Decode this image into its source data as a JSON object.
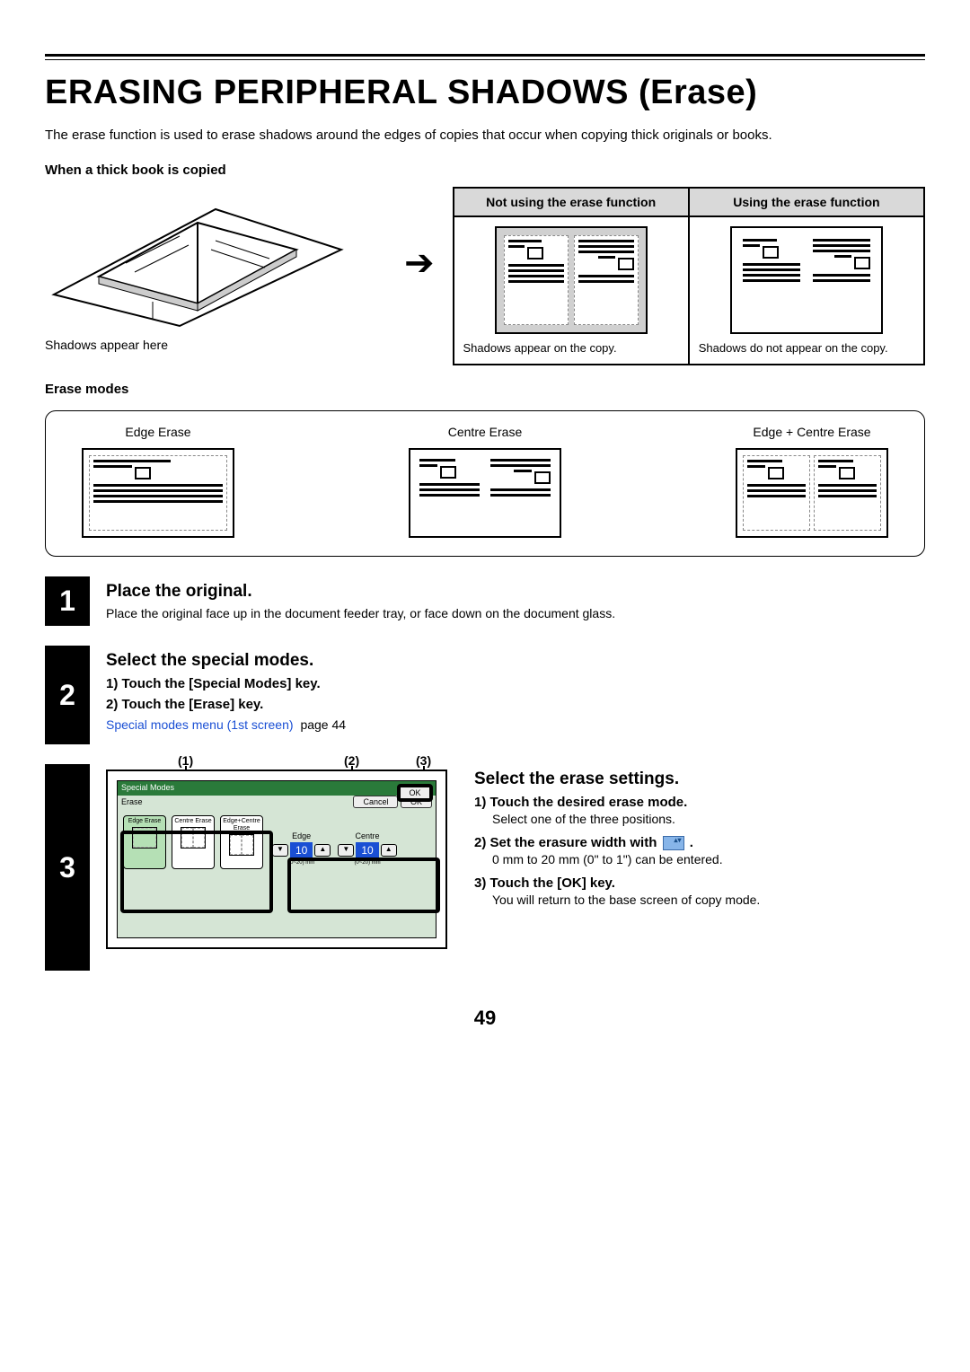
{
  "title": "ERASING PERIPHERAL SHADOWS (Erase)",
  "intro": "The erase function is used to erase shadows around the edges of copies that occur when copying thick originals or books.",
  "thick_book_heading": "When a thick book is copied",
  "book_caption": "Shadows appear here",
  "compare": {
    "left_header": "Not using the erase function",
    "right_header": "Using the erase function",
    "left_caption": "Shadows appear on the copy.",
    "right_caption": "Shadows do not appear on the copy."
  },
  "erase_modes_heading": "Erase modes",
  "modes": {
    "edge": "Edge Erase",
    "centre": "Centre Erase",
    "edge_centre": "Edge + Centre Erase"
  },
  "steps": {
    "s1": {
      "num": "1",
      "title": "Place the original.",
      "text": "Place the original face up in the document feeder tray, or face down on the document glass."
    },
    "s2": {
      "num": "2",
      "title": "Select the special modes.",
      "sub1": "1)  Touch the [Special Modes] key.",
      "sub2": "2)  Touch the [Erase] key.",
      "link": "Special modes menu (1st screen)",
      "pageref": "page 44"
    },
    "s3": {
      "num": "3",
      "title": "Select the erase settings.",
      "sub1": "1)  Touch the desired erase mode.",
      "desc1": "Select one of the three positions.",
      "sub2_a": "2)  Set the erasure width with",
      "sub2_b": ".",
      "desc2": "0 mm to 20 mm (0\" to 1\") can be entered.",
      "sub3": "3)  Touch the [OK] key.",
      "desc3": "You will return to the base screen of copy mode.",
      "callouts": {
        "c1": "(1)",
        "c2": "(2)",
        "c3": "(3)"
      },
      "ts": {
        "title": "Special Modes",
        "subtitle": "Erase",
        "cancel": "Cancel",
        "ok": "OK",
        "edge": "Edge Erase",
        "centre": "Centre Erase",
        "edge_centre": "Edge+Centre Erase",
        "edge_label": "Edge",
        "centre_label": "Centre",
        "value": "10",
        "range": "(0~20) mm"
      }
    }
  },
  "page_number": "49"
}
